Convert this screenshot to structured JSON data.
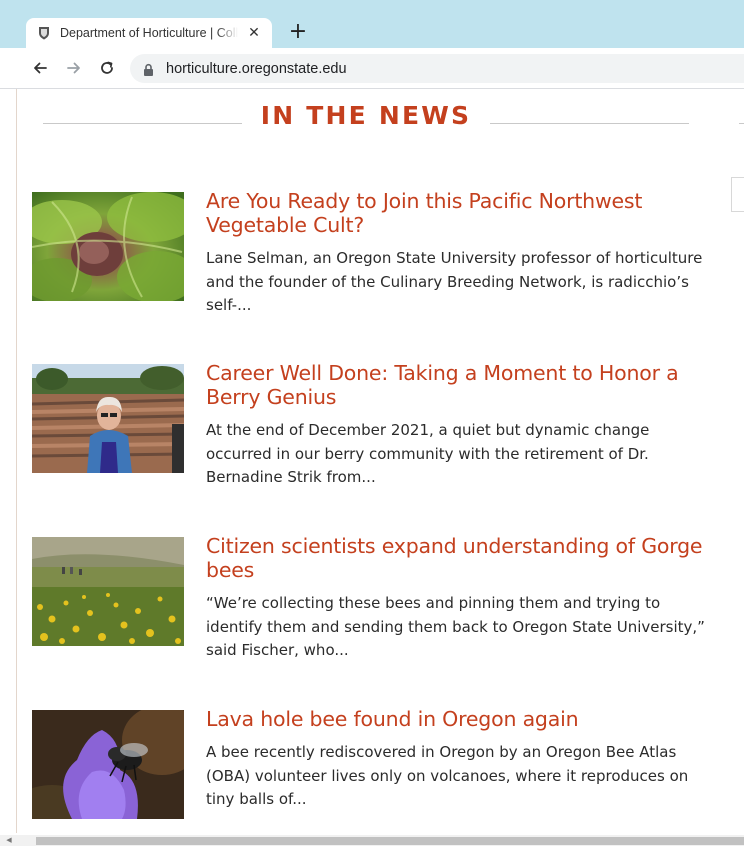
{
  "browser": {
    "tab_title": "Department of Horticulture | College of Agricultural Sciences",
    "tab_close": "✕",
    "new_tab": "+",
    "url": "horticulture.oregonstate.edu"
  },
  "section": {
    "title": "IN THE NEWS"
  },
  "stories": [
    {
      "headline": "Are You Ready to Join this Pacific Northwest Vegetable Cult?",
      "summary": "Lane Selman, an Oregon State University professor of horticulture and the founder of the Culinary Breeding Network, is radicchio’s self-...",
      "image": "radicchio-lettuce-photo"
    },
    {
      "headline": "Career Well Done: Taking a Moment to Honor a Berry Genius",
      "summary": "At the end of December 2021, a quiet but dynamic change occurred in our berry community with the retirement of Dr. Bernadine Strik from...",
      "image": "researcher-in-berry-field-photo"
    },
    {
      "headline": "Citizen scientists expand understanding of Gorge bees",
      "summary": "“We’re collecting these bees and pinning them and trying to identify them and sending them back to Oregon State University,” said Fischer, who...",
      "image": "wildflower-meadow-photo"
    },
    {
      "headline": "Lava hole bee found in Oregon again",
      "summary": "A bee recently rediscovered in Oregon by an Oregon Bee Atlas (OBA) volunteer lives only on volcanoes, where it reproduces on tiny balls of...",
      "image": "bee-on-purple-flower-photo"
    }
  ],
  "colors": {
    "accent": "#c4401e",
    "tabbar": "#bfe3ee"
  }
}
